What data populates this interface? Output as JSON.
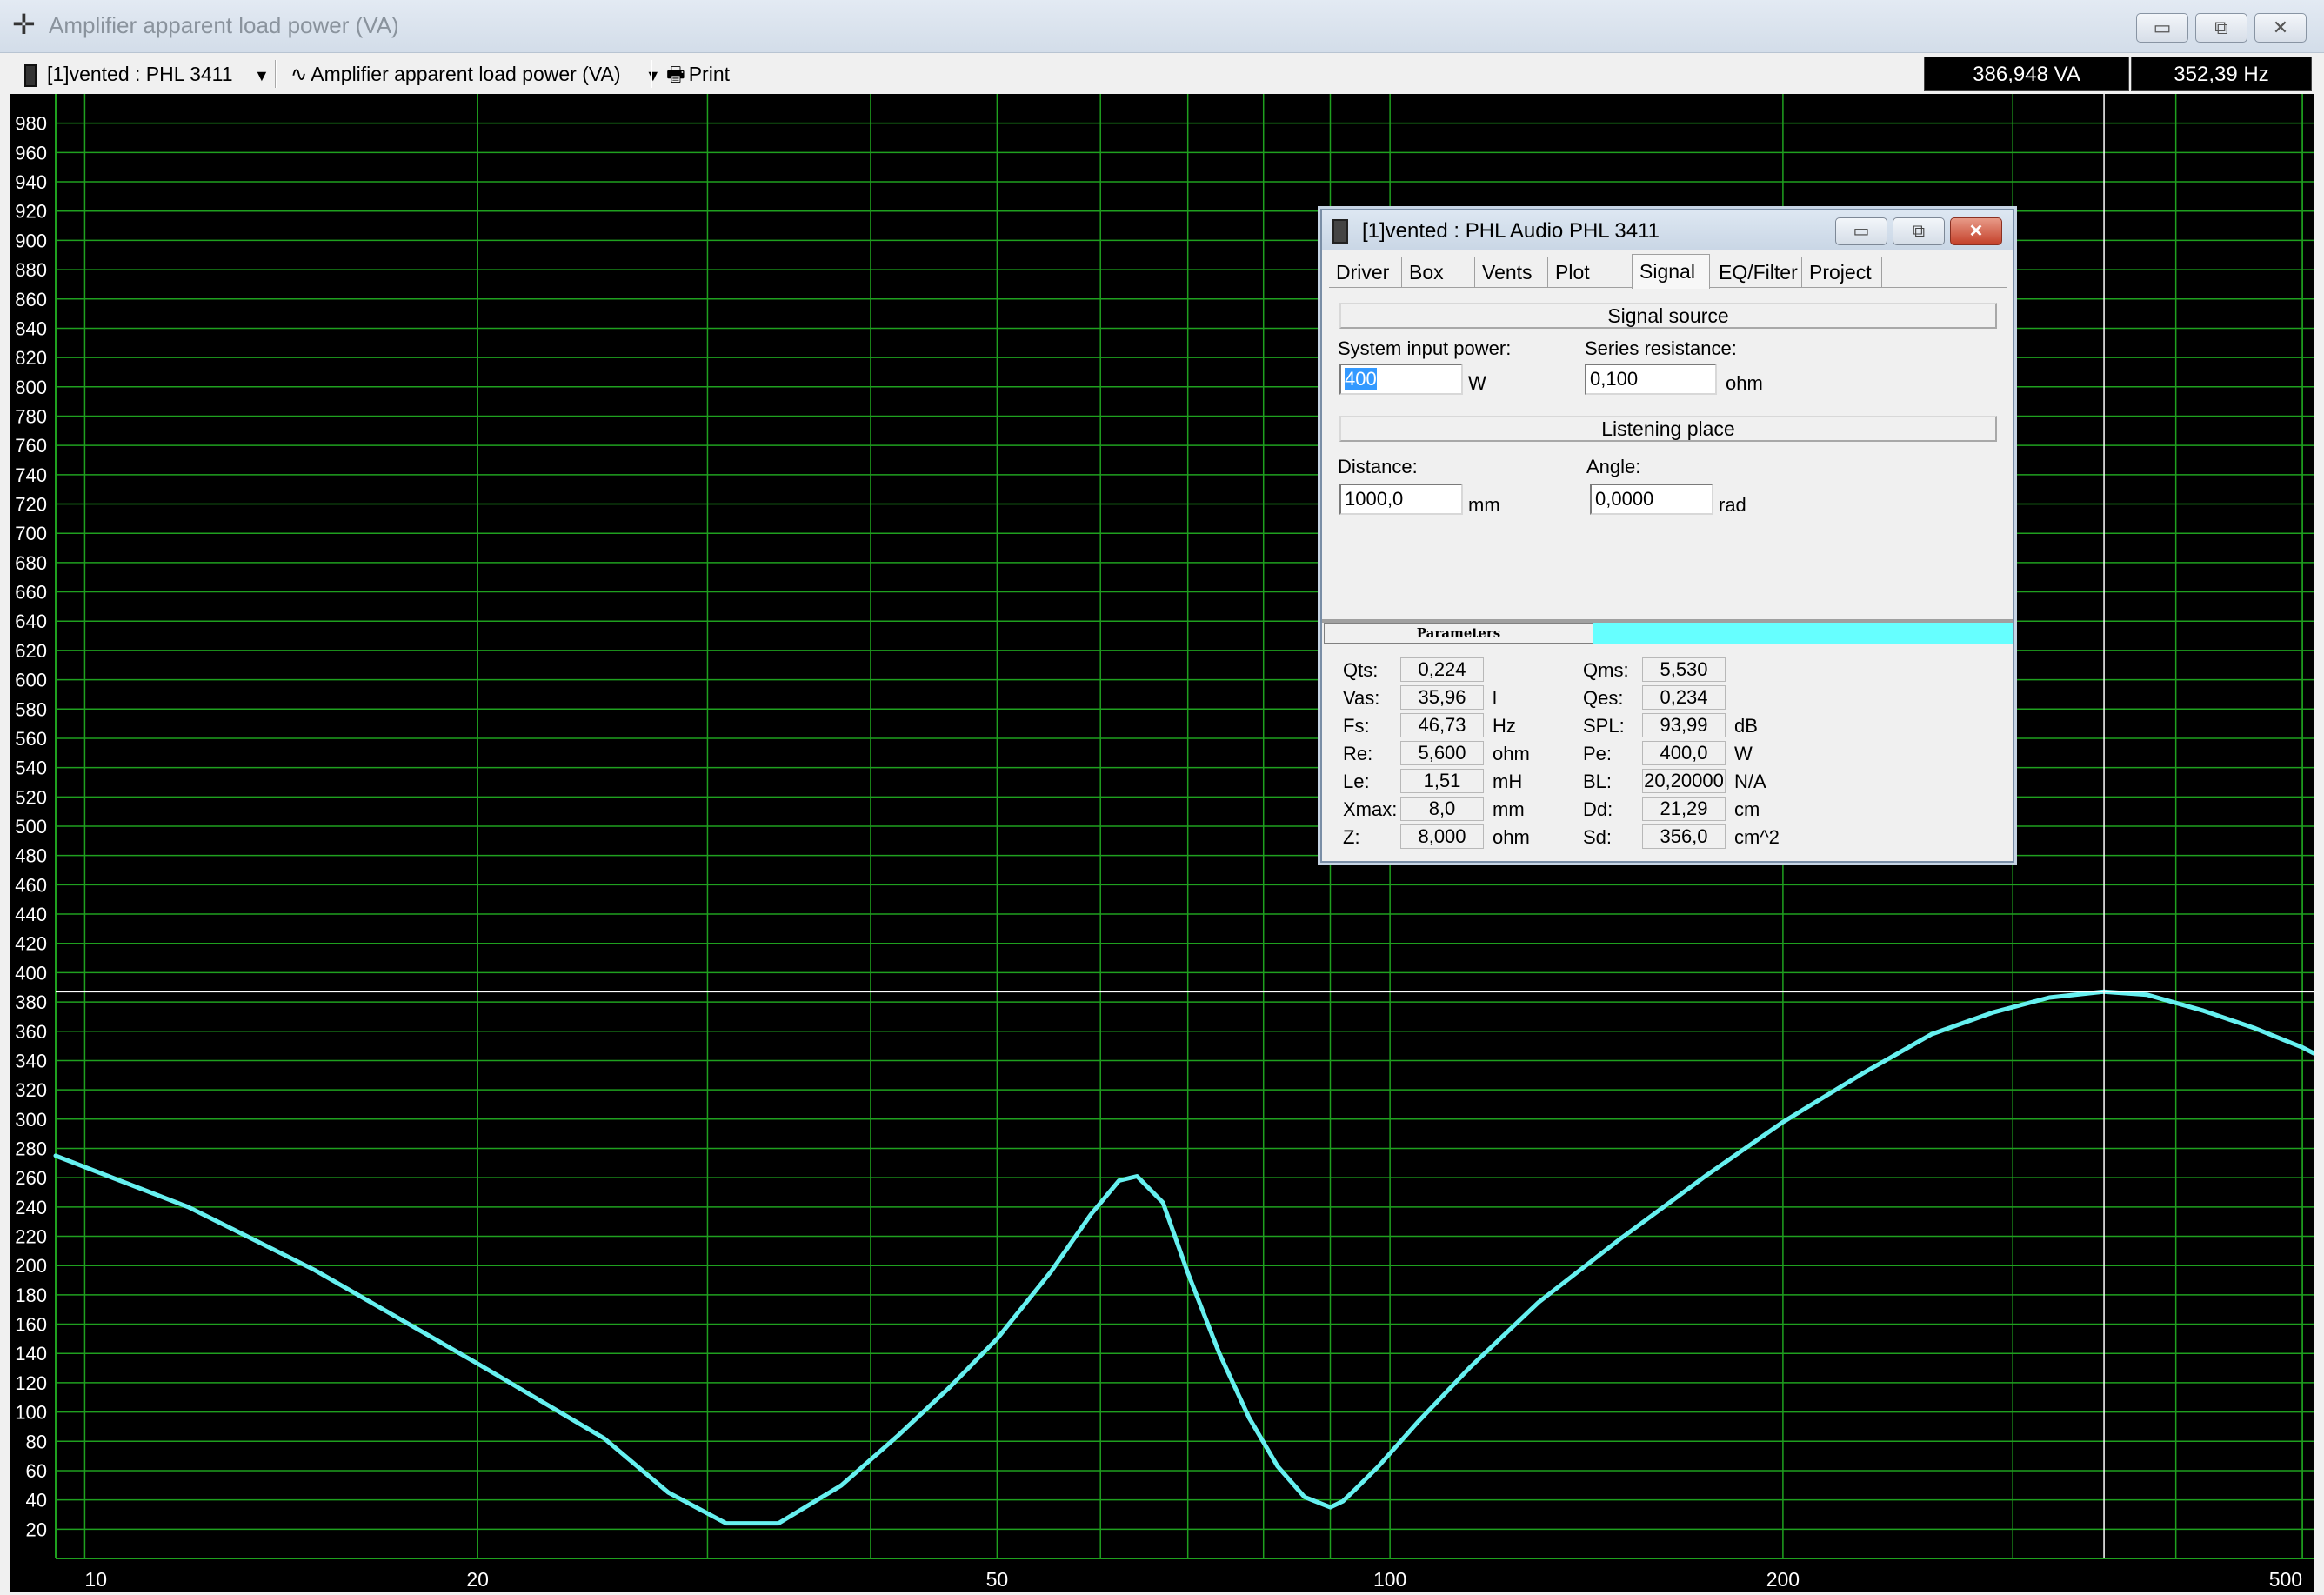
{
  "window": {
    "title": "Amplifier apparent load power (VA)",
    "icon": "crosshair-icon",
    "controls": {
      "minimize": "▭",
      "maximize": "⧉",
      "close": "✕"
    }
  },
  "toolbar": {
    "project_select": "[1]vented : PHL 3411",
    "chart_select": "Amplifier apparent load power (VA)",
    "print_label": "Print",
    "readout_value": "386,948 VA",
    "readout_freq": "352,39 Hz"
  },
  "chart_data": {
    "type": "line",
    "title": "",
    "xlabel": "",
    "ylabel": "",
    "xscale": "log",
    "xlim": [
      9.5,
      510
    ],
    "ylim": [
      0,
      1000
    ],
    "x_ticks": [
      10,
      20,
      50,
      100,
      200,
      500
    ],
    "x_tick_labels": [
      "10",
      "20",
      "50",
      "100",
      "200",
      "500"
    ],
    "y_ticks": [
      20,
      40,
      60,
      80,
      100,
      120,
      140,
      160,
      180,
      200,
      220,
      240,
      260,
      280,
      300,
      320,
      340,
      360,
      380,
      400,
      420,
      440,
      460,
      480,
      500,
      520,
      540,
      560,
      580,
      600,
      620,
      640,
      660,
      680,
      700,
      720,
      740,
      760,
      780,
      800,
      820,
      840,
      860,
      880,
      900,
      920,
      940,
      960,
      980
    ],
    "grid": true,
    "cursor": {
      "x": 352.39,
      "y": 386.948
    },
    "colors": {
      "background": "#000000",
      "grid": "#1fa01f",
      "curve": "#66f0f0",
      "cursor": "#ffffff",
      "tick_text": "#ffffff"
    },
    "series": [
      {
        "x": [
          9.5,
          12,
          15,
          20,
          25,
          28,
          31,
          34,
          38,
          42,
          46,
          50,
          55,
          59,
          62,
          64,
          67,
          70,
          74,
          78,
          82,
          86,
          90,
          92,
          94,
          98,
          105,
          115,
          130,
          150,
          175,
          200,
          230,
          260,
          290,
          320,
          352,
          380,
          420,
          460,
          500,
          510
        ],
        "y": [
          275,
          240,
          197,
          133,
          82,
          45,
          24,
          24,
          50,
          84,
          117,
          150,
          196,
          235,
          258,
          261,
          243,
          195,
          140,
          96,
          63,
          42,
          35,
          39,
          47,
          63,
          93,
          130,
          175,
          218,
          262,
          298,
          331,
          358,
          373,
          383,
          387,
          385,
          374,
          362,
          349,
          345
        ]
      }
    ]
  },
  "dialog": {
    "title": "[1]vented : PHL Audio PHL 3411",
    "controls": {
      "minimize": "▭",
      "maximize": "⧉",
      "close": "✕"
    },
    "tabs": [
      "Driver",
      "Box",
      "Vents",
      "Plot",
      "Signal",
      "EQ/Filter",
      "Project"
    ],
    "active_tab": "Signal",
    "signal_source": {
      "header": "Signal source",
      "input_power_label": "System input power:",
      "input_power_value": "400",
      "input_power_unit": "W",
      "series_resistance_label": "Series resistance:",
      "series_resistance_value": "0,100",
      "series_resistance_unit": "ohm"
    },
    "listening_place": {
      "header": "Listening place",
      "distance_label": "Distance:",
      "distance_value": "1000,0",
      "distance_unit": "mm",
      "angle_label": "Angle:",
      "angle_value": "0,0000",
      "angle_unit": "rad"
    },
    "parameters_tab": "Parameters",
    "params_left": [
      {
        "label": "Qts:",
        "value": "0,224",
        "unit": ""
      },
      {
        "label": "Vas:",
        "value": "35,96",
        "unit": "l"
      },
      {
        "label": "Fs:",
        "value": "46,73",
        "unit": "Hz"
      },
      {
        "label": "Re:",
        "value": "5,600",
        "unit": "ohm"
      },
      {
        "label": "Le:",
        "value": "1,51",
        "unit": "mH"
      },
      {
        "label": "Xmax:",
        "value": "8,0",
        "unit": "mm"
      },
      {
        "label": "Z:",
        "value": "8,000",
        "unit": "ohm"
      }
    ],
    "params_right": [
      {
        "label": "Qms:",
        "value": "5,530",
        "unit": ""
      },
      {
        "label": "Qes:",
        "value": "0,234",
        "unit": ""
      },
      {
        "label": "SPL:",
        "value": "93,99",
        "unit": "dB"
      },
      {
        "label": "Pe:",
        "value": "400,0",
        "unit": "W"
      },
      {
        "label": "BL:",
        "value": "20,20000",
        "unit": "N/A"
      },
      {
        "label": "Dd:",
        "value": "21,29",
        "unit": "cm"
      },
      {
        "label": "Sd:",
        "value": "356,0",
        "unit": "cm^2"
      }
    ]
  }
}
